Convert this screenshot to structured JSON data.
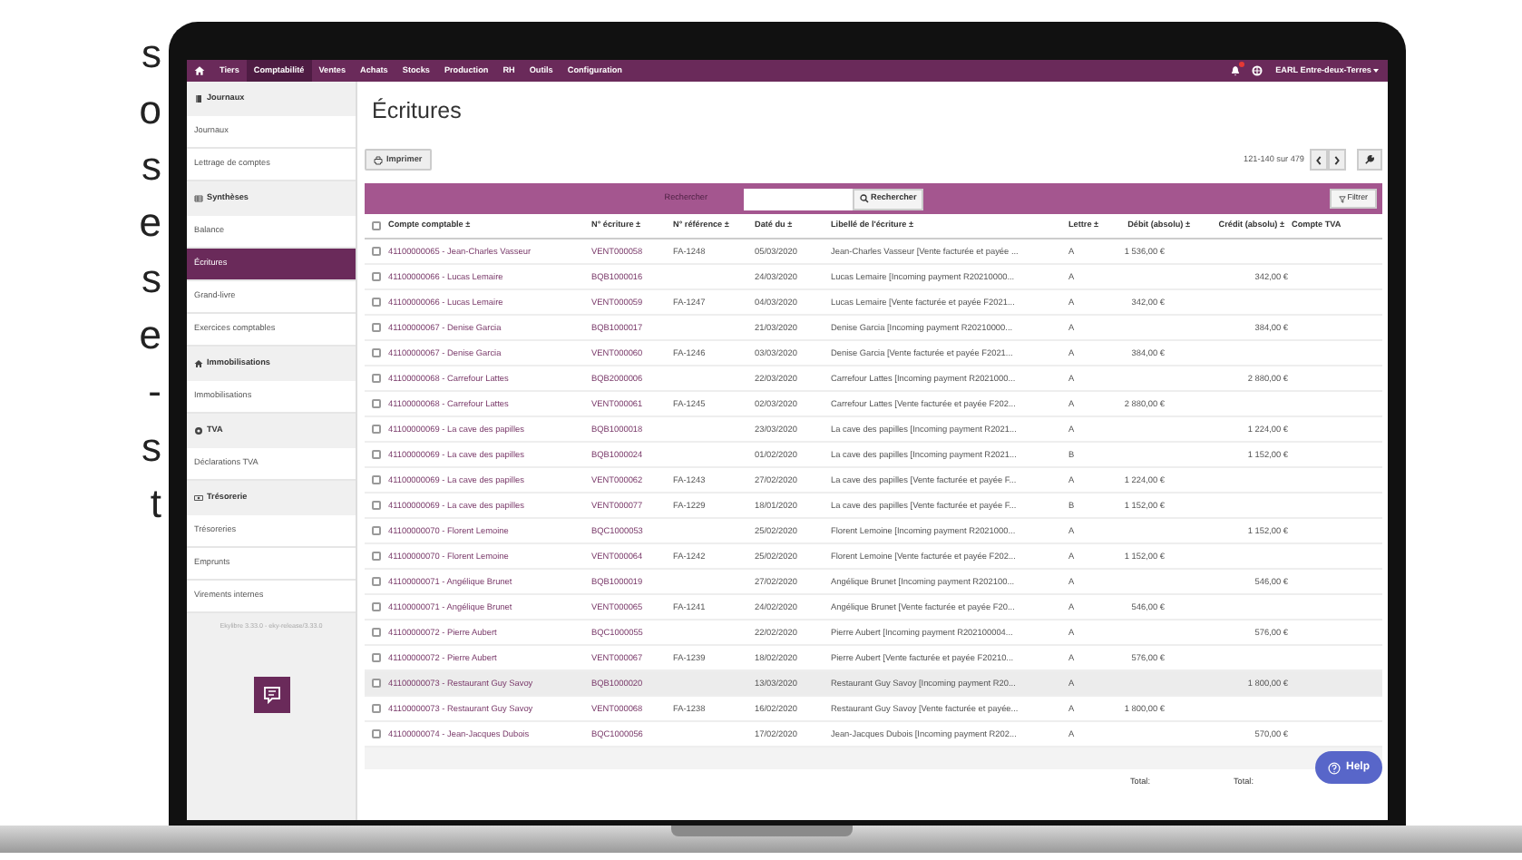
{
  "side_text": [
    "s",
    "o",
    "s",
    "e",
    "s",
    "e",
    "-",
    "s",
    "t"
  ],
  "topbar": {
    "nav": [
      {
        "label": "Tiers",
        "selected": false
      },
      {
        "label": "Comptabilité",
        "selected": true
      },
      {
        "label": "Ventes",
        "selected": false
      },
      {
        "label": "Achats",
        "selected": false
      },
      {
        "label": "Stocks",
        "selected": false
      },
      {
        "label": "Production",
        "selected": false
      },
      {
        "label": "RH",
        "selected": false
      },
      {
        "label": "Outils",
        "selected": false
      },
      {
        "label": "Configuration",
        "selected": false
      }
    ],
    "account": "EARL Entre-deux-Terres"
  },
  "sidebar": {
    "sections": [
      {
        "title": "Journaux",
        "items": [
          {
            "label": "Journaux",
            "selected": false
          },
          {
            "label": "Lettrage de comptes",
            "selected": false
          }
        ]
      },
      {
        "title": "Synthèses",
        "items": [
          {
            "label": "Balance",
            "selected": false
          },
          {
            "label": "Écritures",
            "selected": true
          },
          {
            "label": "Grand-livre",
            "selected": false
          },
          {
            "label": "Exercices comptables",
            "selected": false
          }
        ]
      },
      {
        "title": "Immobilisations",
        "items": [
          {
            "label": "Immobilisations",
            "selected": false
          }
        ]
      },
      {
        "title": "TVA",
        "items": [
          {
            "label": "Déclarations TVA",
            "selected": false
          }
        ]
      },
      {
        "title": "Trésorerie",
        "items": [
          {
            "label": "Trésoreries",
            "selected": false
          },
          {
            "label": "Emprunts",
            "selected": false
          },
          {
            "label": "Virements internes",
            "selected": false
          }
        ]
      }
    ],
    "version": "Ekylibre 3.33.0 - eky-release/3.33.0"
  },
  "page": {
    "title": "Écritures",
    "print_button": "Imprimer",
    "pagination": "121-140 sur 479",
    "search": {
      "label": "Rechercher",
      "button": "Rechercher"
    },
    "filter_button": "Filtrer"
  },
  "table": {
    "header_checked": false,
    "columns": [
      "Compte comptable ±",
      "N° écriture ±",
      "N° référence ±",
      "Daté du ±",
      "Libellé de l'écriture ±",
      "Lettre ±",
      "Débit (absolu) ±",
      "Crédit (absolu) ±",
      "Compte TVA"
    ],
    "rows": [
      {
        "checked": false,
        "hovered": false,
        "cells": [
          "41100000065 - Jean-Charles Vasseur",
          "VENT000058",
          "FA-1248",
          "05/03/2020",
          "Jean-Charles Vasseur [Vente facturée et payée ...",
          "A",
          "1 536,00 €",
          ""
        ]
      },
      {
        "checked": false,
        "hovered": false,
        "cells": [
          "41100000066 - Lucas Lemaire",
          "BQB1000016",
          "",
          "24/03/2020",
          "Lucas Lemaire [Incoming payment R20210000...",
          "A",
          "",
          "342,00 €"
        ]
      },
      {
        "checked": false,
        "hovered": false,
        "cells": [
          "41100000066 - Lucas Lemaire",
          "VENT000059",
          "FA-1247",
          "04/03/2020",
          "Lucas Lemaire [Vente facturée et payée F2021...",
          "A",
          "342,00 €",
          ""
        ]
      },
      {
        "checked": false,
        "hovered": false,
        "cells": [
          "41100000067 - Denise Garcia",
          "BQB1000017",
          "",
          "21/03/2020",
          "Denise Garcia [Incoming payment R20210000...",
          "A",
          "",
          "384,00 €"
        ]
      },
      {
        "checked": false,
        "hovered": false,
        "cells": [
          "41100000067 - Denise Garcia",
          "VENT000060",
          "FA-1246",
          "03/03/2020",
          "Denise Garcia [Vente facturée et payée F2021...",
          "A",
          "384,00 €",
          ""
        ]
      },
      {
        "checked": false,
        "hovered": false,
        "cells": [
          "41100000068 - Carrefour Lattes",
          "BQB2000006",
          "",
          "22/03/2020",
          "Carrefour Lattes [Incoming payment R2021000...",
          "A",
          "",
          "2 880,00 €"
        ]
      },
      {
        "checked": false,
        "hovered": false,
        "cells": [
          "41100000068 - Carrefour Lattes",
          "VENT000061",
          "FA-1245",
          "02/03/2020",
          "Carrefour Lattes [Vente facturée et payée F202...",
          "A",
          "2 880,00 €",
          ""
        ]
      },
      {
        "checked": false,
        "hovered": false,
        "cells": [
          "41100000069 - La cave des papilles",
          "BQB1000018",
          "",
          "23/03/2020",
          "La cave des papilles [Incoming payment R2021...",
          "A",
          "",
          "1 224,00 €"
        ]
      },
      {
        "checked": false,
        "hovered": false,
        "cells": [
          "41100000069 - La cave des papilles",
          "BQB1000024",
          "",
          "01/02/2020",
          "La cave des papilles [Incoming payment R2021...",
          "B",
          "",
          "1 152,00 €"
        ]
      },
      {
        "checked": false,
        "hovered": false,
        "cells": [
          "41100000069 - La cave des papilles",
          "VENT000062",
          "FA-1243",
          "27/02/2020",
          "La cave des papilles [Vente facturée et payée F...",
          "A",
          "1 224,00 €",
          ""
        ]
      },
      {
        "checked": false,
        "hovered": false,
        "cells": [
          "41100000069 - La cave des papilles",
          "VENT000077",
          "FA-1229",
          "18/01/2020",
          "La cave des papilles [Vente facturée et payée F...",
          "B",
          "1 152,00 €",
          ""
        ]
      },
      {
        "checked": false,
        "hovered": false,
        "cells": [
          "41100000070 - Florent Lemoine",
          "BQC1000053",
          "",
          "25/02/2020",
          "Florent Lemoine [Incoming payment R2021000...",
          "A",
          "",
          "1 152,00 €"
        ]
      },
      {
        "checked": false,
        "hovered": false,
        "cells": [
          "41100000070 - Florent Lemoine",
          "VENT000064",
          "FA-1242",
          "25/02/2020",
          "Florent Lemoine [Vente facturée et payée F202...",
          "A",
          "1 152,00 €",
          ""
        ]
      },
      {
        "checked": false,
        "hovered": false,
        "cells": [
          "41100000071 - Angélique Brunet",
          "BQB1000019",
          "",
          "27/02/2020",
          "Angélique Brunet [Incoming payment R202100...",
          "A",
          "",
          "546,00 €"
        ]
      },
      {
        "checked": false,
        "hovered": false,
        "cells": [
          "41100000071 - Angélique Brunet",
          "VENT000065",
          "FA-1241",
          "24/02/2020",
          "Angélique Brunet [Vente facturée et payée F20...",
          "A",
          "546,00 €",
          ""
        ]
      },
      {
        "checked": false,
        "hovered": false,
        "cells": [
          "41100000072 - Pierre Aubert",
          "BQC1000055",
          "",
          "22/02/2020",
          "Pierre Aubert [Incoming payment R202100004...",
          "A",
          "",
          "576,00 €"
        ]
      },
      {
        "checked": false,
        "hovered": false,
        "cells": [
          "41100000072 - Pierre Aubert",
          "VENT000067",
          "FA-1239",
          "18/02/2020",
          "Pierre Aubert [Vente facturée et payée F20210...",
          "A",
          "576,00 €",
          ""
        ]
      },
      {
        "checked": false,
        "hovered": true,
        "cells": [
          "41100000073 - Restaurant Guy Savoy",
          "BQB1000020",
          "",
          "13/03/2020",
          "Restaurant Guy Savoy [Incoming payment R20...",
          "A",
          "",
          "1 800,00 €"
        ]
      },
      {
        "checked": false,
        "hovered": false,
        "cells": [
          "41100000073 - Restaurant Guy Savoy",
          "VENT000068",
          "FA-1238",
          "16/02/2020",
          "Restaurant Guy Savoy [Vente facturée et payée...",
          "A",
          "1 800,00 €",
          ""
        ]
      },
      {
        "checked": false,
        "hovered": false,
        "cells": [
          "41100000074 - Jean-Jacques Dubois",
          "BQC1000056",
          "",
          "17/02/2020",
          "Jean-Jacques Dubois [Incoming payment R202...",
          "A",
          "",
          "570,00 €"
        ]
      }
    ],
    "totals": [
      "Total:",
      "Total:"
    ]
  },
  "help_button": "Help"
}
